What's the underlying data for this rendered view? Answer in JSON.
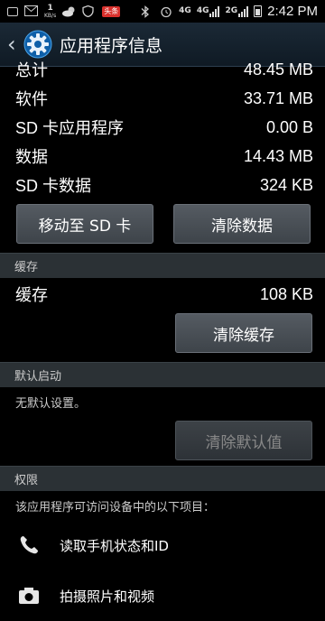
{
  "status": {
    "net_speed_value": "1",
    "net_speed_unit": "KB/s",
    "red_badge": "头条",
    "signal1": "4G",
    "signal2": "4G",
    "signal3": "2G",
    "time": "2:42 PM"
  },
  "actionbar": {
    "title": "应用程序信息",
    "icon": "settings-gear-icon"
  },
  "storage": [
    {
      "label": "总计",
      "value": "48.45 MB"
    },
    {
      "label": "软件",
      "value": "33.71 MB"
    },
    {
      "label": "SD 卡应用程序",
      "value": "0.00 B"
    },
    {
      "label": "数据",
      "value": "14.43 MB"
    },
    {
      "label": "SD 卡数据",
      "value": "324 KB"
    }
  ],
  "buttons": {
    "move_sd": "移动至 SD 卡",
    "clear_data": "清除数据",
    "clear_cache": "清除缓存",
    "clear_defaults": "清除默认值"
  },
  "cache": {
    "header": "缓存",
    "label": "缓存",
    "value": "108 KB"
  },
  "defaults": {
    "header": "默认启动",
    "note": "无默认设置。"
  },
  "permissions": {
    "header": "权限",
    "note": "该应用程序可访问设备中的以下项目：",
    "items": [
      {
        "label": "读取手机状态和ID",
        "icon": "phone-icon"
      },
      {
        "label": "拍摄照片和视频",
        "icon": "camera-icon"
      }
    ]
  }
}
